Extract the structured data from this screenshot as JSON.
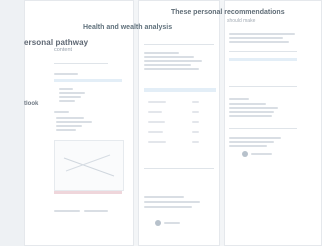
{
  "left_page": {
    "title": "ersonal pathway",
    "subtitle": "content",
    "section_title": "tlook"
  },
  "middle_page": {
    "title": "Health and wealth analysis"
  },
  "right_page": {
    "title": "These personal recommendations",
    "subtitle": "should make"
  }
}
